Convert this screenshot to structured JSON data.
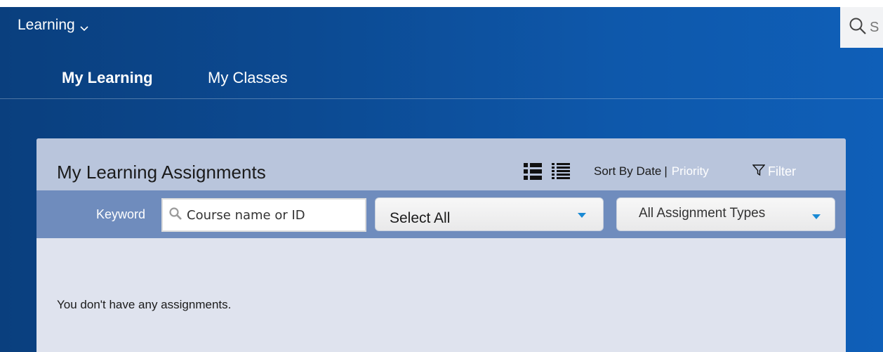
{
  "app": {
    "switcher_label": "Learning"
  },
  "search": {
    "placeholder_visible": "S"
  },
  "nav": {
    "tabs": [
      {
        "label": "My Learning",
        "active": true
      },
      {
        "label": "My Classes",
        "active": false
      }
    ]
  },
  "panel": {
    "title": "My Learning Assignments",
    "sort": {
      "prefix": "Sort By Date",
      "separator": "|",
      "priority_label": "Priority"
    },
    "filter_label": "Filter",
    "keyword_label": "Keyword",
    "keyword_placeholder": "Course name or ID",
    "status_dropdown_value": "Select All",
    "types_dropdown_value": "All Assignment Types",
    "empty_message": "You don't have any assignments."
  },
  "colors": {
    "header_bg": "#0c4a92",
    "panel_header_bg": "#b9c5dc",
    "filter_bar_bg": "#6f8cbd",
    "panel_body_bg": "#dfe3ee",
    "accent_arrow": "#1a8ad4"
  },
  "icons": [
    "chevron-down-icon",
    "search-icon",
    "card-view-icon",
    "list-view-icon",
    "filter-icon",
    "magnifier-icon",
    "dropdown-arrow-icon"
  ]
}
